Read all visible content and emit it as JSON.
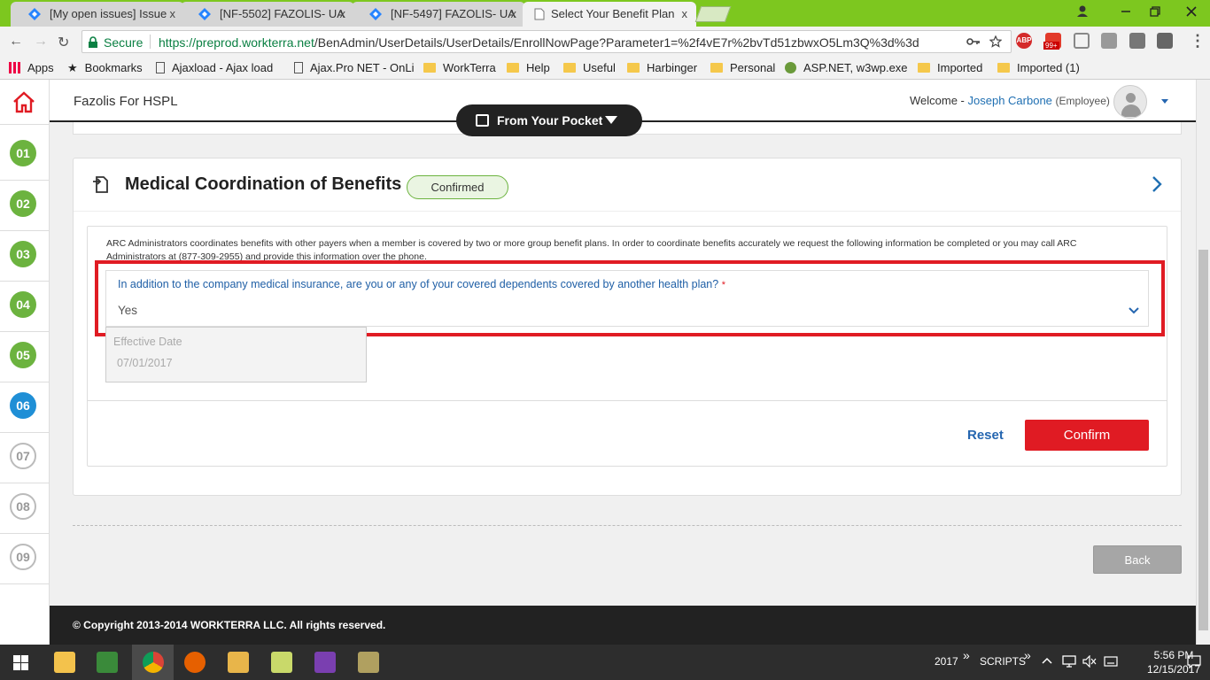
{
  "browser": {
    "tabs": [
      {
        "label": "[My open issues] Issue",
        "active": false
      },
      {
        "label": "[NF-5502] FAZOLIS- UA",
        "active": false
      },
      {
        "label": "[NF-5497] FAZOLIS- UA",
        "active": false
      },
      {
        "label": "Select Your Benefit Plan",
        "active": true
      }
    ],
    "close_glyph": "x",
    "secure_label": "Secure",
    "url_host": "https://preprod.workterra.net",
    "url_path": "/BenAdmin/UserDetails/UserDetails/EnrollNowPage?Parameter1=%2f4vE7r%2bvTd51zbwxO5Lm3Q%3d%3d",
    "bookmarks": [
      {
        "label": "Apps",
        "icon": "apps-grid-icon"
      },
      {
        "label": "Bookmarks",
        "icon": "star-icon"
      },
      {
        "label": "Ajaxload - Ajax load",
        "icon": "page-icon"
      },
      {
        "label": "Ajax.Pro NET - OnLi",
        "icon": "page-icon"
      },
      {
        "label": "WorkTerra",
        "icon": "folder-icon"
      },
      {
        "label": "Help",
        "icon": "folder-icon"
      },
      {
        "label": "Useful",
        "icon": "folder-icon"
      },
      {
        "label": "Harbinger",
        "icon": "folder-icon"
      },
      {
        "label": "Personal",
        "icon": "folder-icon"
      },
      {
        "label": "ASP.NET, w3wp.exe",
        "icon": "leaf-icon"
      },
      {
        "label": "Imported",
        "icon": "folder-icon"
      },
      {
        "label": "Imported (1)",
        "icon": "folder-icon"
      }
    ],
    "ext_badge": "99+"
  },
  "nav": {
    "steps": [
      {
        "label": "01",
        "state": "done"
      },
      {
        "label": "02",
        "state": "done"
      },
      {
        "label": "03",
        "state": "done"
      },
      {
        "label": "04",
        "state": "done"
      },
      {
        "label": "05",
        "state": "done"
      },
      {
        "label": "06",
        "state": "current"
      },
      {
        "label": "07",
        "state": "todo"
      },
      {
        "label": "08",
        "state": "todo"
      },
      {
        "label": "09",
        "state": "todo"
      }
    ]
  },
  "header": {
    "company": "Fazolis For HSPL",
    "pocket_label": "From Your Pocket",
    "welcome": "Welcome -",
    "user_name": "Joseph Carbone",
    "user_role": "(Employee)"
  },
  "card": {
    "title": "Medical Coordination of Benefits",
    "status": "Confirmed",
    "info": "ARC Administrators coordinates benefits with other payers when a member is covered by two or more group benefit plans. In order to coordinate benefits accurately we request the following information be completed or you may call ARC Administrators at (877-309-2955) and provide this information over the phone.",
    "question": "In addition to the company medical insurance, are you or any of your covered dependents covered by another health plan?",
    "required_mark": "*",
    "answer": "Yes",
    "effective_label": "Effective Date",
    "effective_value": "07/01/2017",
    "reset_label": "Reset",
    "confirm_label": "Confirm"
  },
  "back_label": "Back",
  "footer": "© Copyright 2013-2014 WORKTERRA LLC. All rights reserved.",
  "taskbar": {
    "year_label": "2017",
    "scripts_label": "SCRIPTS",
    "chevron": "»",
    "time": "5:56 PM",
    "date": "12/15/2017"
  },
  "colors": {
    "accent_red": "#e01b23",
    "step_done": "#6cb33f",
    "step_current": "#1f8fd6",
    "link_blue": "#2566b0",
    "chrome_green": "#7dc71f"
  }
}
